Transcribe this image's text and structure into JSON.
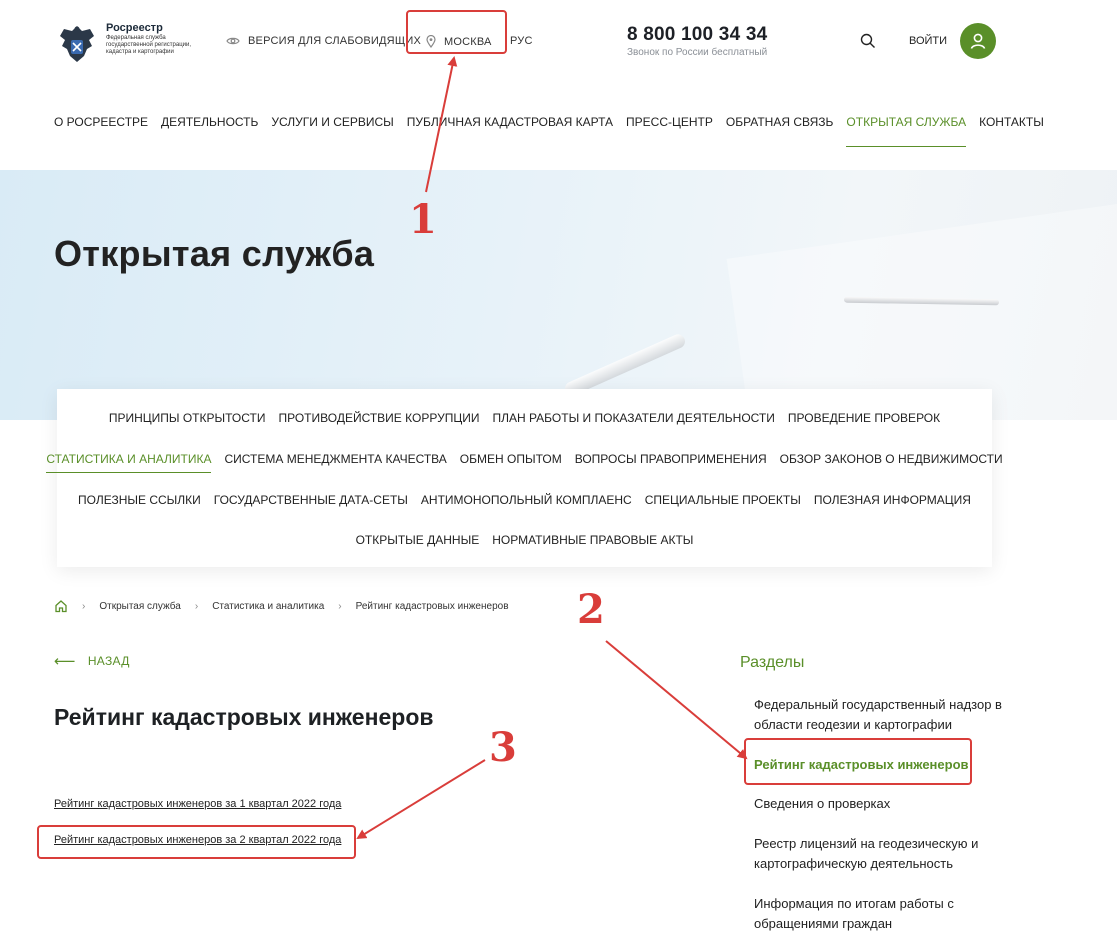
{
  "header": {
    "logo": {
      "name": "Росреестр",
      "subtitle": "Федеральная служба государственной регистрации, кадастра и картографии"
    },
    "accessibility_label": "ВЕРСИЯ ДЛЯ СЛАБОВИДЯЩИХ",
    "region_label": "МОСКВА",
    "language_label": "РУС",
    "phone": "8 800 100 34 34",
    "phone_note": "Звонок по России бесплатный",
    "login_label": "ВОЙТИ"
  },
  "main_nav": [
    {
      "label": "О РОСРЕЕСТРЕ"
    },
    {
      "label": "ДЕЯТЕЛЬНОСТЬ"
    },
    {
      "label": "УСЛУГИ И СЕРВИСЫ"
    },
    {
      "label": "ПУБЛИЧНАЯ КАДАСТРОВАЯ КАРТА"
    },
    {
      "label": "ПРЕСС-ЦЕНТР"
    },
    {
      "label": "ОБРАТНАЯ СВЯЗЬ"
    },
    {
      "label": "ОТКРЫТАЯ СЛУЖБА",
      "active": true
    },
    {
      "label": "КОНТАКТЫ"
    }
  ],
  "hero": {
    "title": "Открытая служба"
  },
  "submenu": [
    [
      "ПРИНЦИПЫ ОТКРЫТОСТИ",
      "ПРОТИВОДЕЙСТВИЕ КОРРУПЦИИ",
      "ПЛАН РАБОТЫ И ПОКАЗАТЕЛИ ДЕЯТЕЛЬНОСТИ",
      "ПРОВЕДЕНИЕ ПРОВЕРОК"
    ],
    [
      "СТАТИСТИКА И АНАЛИТИКА",
      "СИСТЕМА МЕНЕДЖМЕНТА КАЧЕСТВА",
      "ОБМЕН ОПЫТОМ",
      "ВОПРОСЫ ПРАВОПРИМЕНЕНИЯ",
      "ОБЗОР ЗАКОНОВ О НЕДВИЖИМОСТИ"
    ],
    [
      "ПОЛЕЗНЫЕ ССЫЛКИ",
      "ГОСУДАРСТВЕННЫЕ ДАТА-СЕТЫ",
      "АНТИМОНОПОЛЬНЫЙ КОМПЛАЕНС",
      "СПЕЦИАЛЬНЫЕ ПРОЕКТЫ",
      "ПОЛЕЗНАЯ ИНФОРМАЦИЯ"
    ],
    [
      "ОТКРЫТЫЕ ДАННЫЕ",
      "НОРМАТИВНЫЕ ПРАВОВЫЕ АКТЫ"
    ]
  ],
  "submenu_active": "СТАТИСТИКА И АНАЛИТИКА",
  "breadcrumbs": [
    "Открытая служба",
    "Статистика и аналитика",
    "Рейтинг кадастровых инженеров"
  ],
  "back_label": "НАЗАД",
  "page_title": "Рейтинг кадастровых инженеров",
  "documents": [
    "Рейтинг кадастровых инженеров за 1 квартал 2022 года",
    "Рейтинг кадастровых инженеров за 2 квартал 2022 года"
  ],
  "sidebar": {
    "title": "Разделы",
    "items": [
      {
        "label": "Федеральный государственный надзор в области геодезии и картографии"
      },
      {
        "label": "Рейтинг кадастровых инженеров",
        "active": true
      },
      {
        "label": "Сведения о проверках"
      },
      {
        "label": "Реестр лицензий на геодезическую и картографическую деятельность"
      },
      {
        "label": "Информация по итогам работы с обращениями граждан"
      }
    ]
  },
  "annotations": [
    "1",
    "2",
    "3"
  ],
  "colors": {
    "accent_green": "#5a8f29",
    "annotation_red": "#d93d3a"
  }
}
